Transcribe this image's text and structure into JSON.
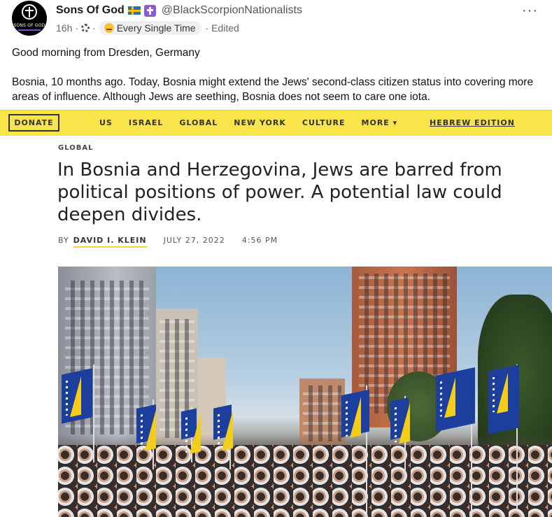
{
  "post": {
    "author_name": "Sons Of God",
    "handle": "@BlackScorpionNationalists",
    "time": "16h",
    "flair": "Every Single Time",
    "edited": "· Edited",
    "avatar_text": "SONS OF GOD",
    "more": "···",
    "paragraph_1": "Good morning from Dresden, Germany",
    "paragraph_2": "Bosnia, 10 months ago. Today, Bosnia might extend the Jews' second-class citizen status into covering more areas of influence. Although Jews are seething, Bosnia does not seem to care one iota."
  },
  "article": {
    "nav": {
      "donate": "DONATE",
      "items": [
        "US",
        "ISRAEL",
        "GLOBAL",
        "NEW YORK",
        "CULTURE",
        "MORE ▾"
      ],
      "hebrew": "HEBREW EDITION"
    },
    "section": "GLOBAL",
    "title": "In Bosnia and Herzegovina, Jews are barred from political positions of power. A potential law could deepen divides.",
    "by": "BY",
    "author": "DAVID I. KLEIN",
    "date": "JULY 27, 2022",
    "time": "4:56 PM"
  },
  "colors": {
    "nav_yellow": "#f9e54a",
    "flag_blue": "#1c3e9c",
    "flag_yellow": "#f2cd1c"
  },
  "icons": [
    "swedish-flag-icon",
    "latin-cross-icon",
    "globe-icon",
    "rolling-eyes-emoji-icon",
    "more-options-icon"
  ]
}
